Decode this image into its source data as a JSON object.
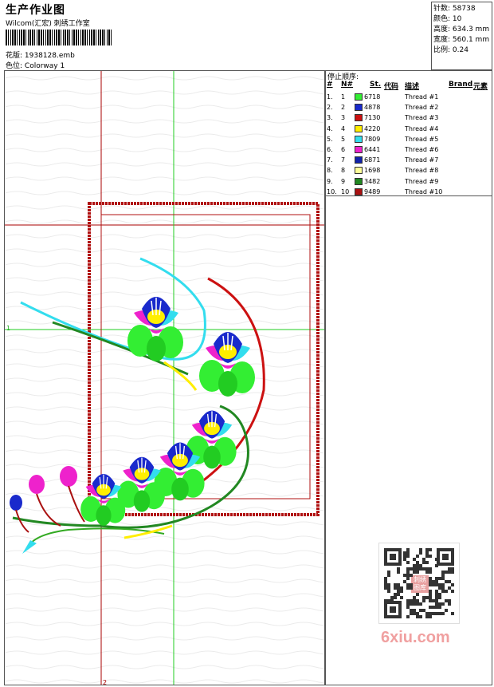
{
  "header": {
    "title": "生产作业图",
    "subtitle": "Wilcom(汇宏) 刺绣工作室",
    "file_label": "花版:",
    "file_value": "1938128.emb",
    "colorway_label": "色位:",
    "colorway_value": "Colorway 1"
  },
  "stats": {
    "stitches_label": "针数:",
    "stitches_value": "58738",
    "colors_label": "颜色:",
    "colors_value": "10",
    "height_label": "高度:",
    "height_value": "634.3 mm",
    "width_label": "宽度:",
    "width_value": "560.1 mm",
    "scale_label": "比例:",
    "scale_value": "0.24"
  },
  "sequence": {
    "title": "停止顺序:",
    "headers": {
      "num": "#",
      "n": "N#",
      "st": "St.",
      "code": "代码",
      "desc": "描述",
      "brand": "Brand",
      "elem": "元素"
    },
    "rows": [
      {
        "num": "1.",
        "n": "1",
        "color": "#33ee33",
        "code": "6718",
        "desc": "Thread #1"
      },
      {
        "num": "2.",
        "n": "2",
        "color": "#1a2acc",
        "code": "4878",
        "desc": "Thread #2"
      },
      {
        "num": "3.",
        "n": "3",
        "color": "#cc1111",
        "code": "7130",
        "desc": "Thread #3"
      },
      {
        "num": "4.",
        "n": "4",
        "color": "#ffee00",
        "code": "4220",
        "desc": "Thread #4"
      },
      {
        "num": "5.",
        "n": "5",
        "color": "#33ddee",
        "code": "7809",
        "desc": "Thread #5"
      },
      {
        "num": "6.",
        "n": "6",
        "color": "#ee22cc",
        "code": "6441",
        "desc": "Thread #6"
      },
      {
        "num": "7.",
        "n": "7",
        "color": "#1122aa",
        "code": "6871",
        "desc": "Thread #7"
      },
      {
        "num": "8.",
        "n": "8",
        "color": "#ffff99",
        "code": "1698",
        "desc": "Thread #8"
      },
      {
        "num": "9.",
        "n": "9",
        "color": "#228822",
        "code": "3482",
        "desc": "Thread #9"
      },
      {
        "num": "10.",
        "n": "10",
        "color": "#aa1111",
        "code": "9489",
        "desc": "Thread #10"
      }
    ]
  },
  "canvas": {
    "marker_1": "1",
    "marker_2": "2",
    "marker_top": "1"
  },
  "watermark": {
    "text": "6xiu.com",
    "qr_stamp": "刺绣图库"
  }
}
